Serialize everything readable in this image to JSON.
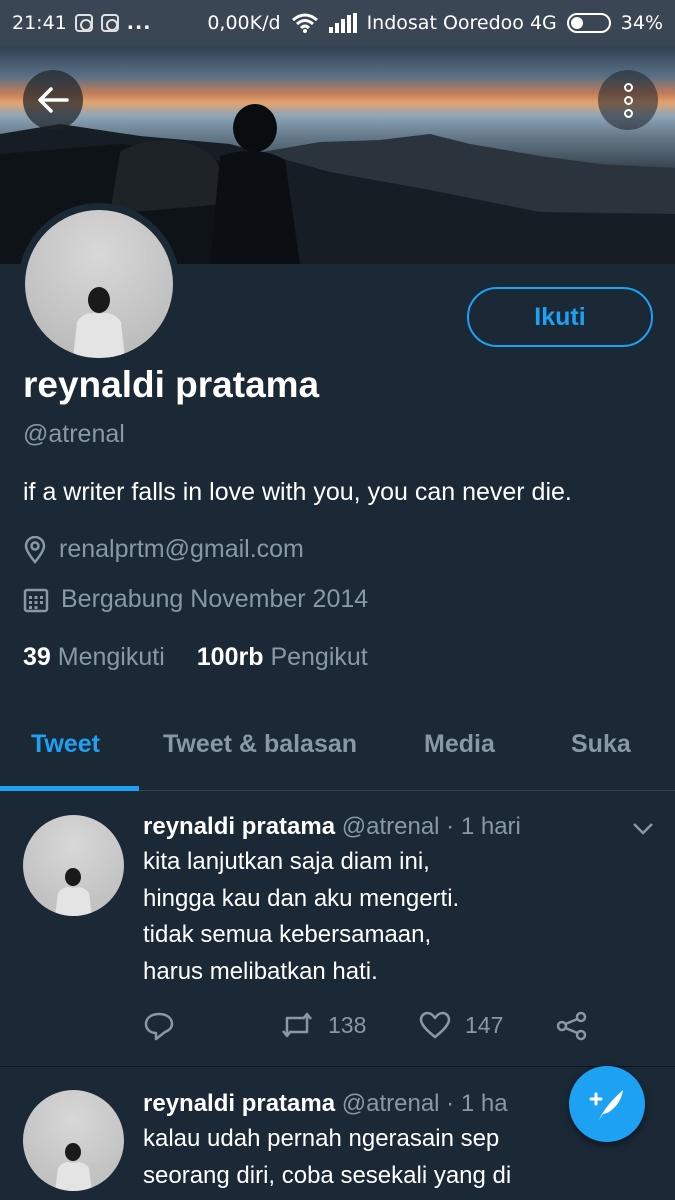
{
  "status_bar": {
    "time": "21:41",
    "dots": "...",
    "speed": "0,00K/d",
    "carrier": "Indosat Ooredoo 4G",
    "battery": "34%",
    "battery_level": 0.34
  },
  "profile": {
    "name": "reynaldi pratama",
    "handle": "@atrenal",
    "bio": "if a writer falls in love with you, you can never die.",
    "email": "renalprtm@gmail.com",
    "joined": "Bergabung November 2014",
    "following_count": "39",
    "following_label": "Mengikuti",
    "followers_count": "100rb",
    "followers_label": "Pengikut",
    "follow_button": "Ikuti"
  },
  "tabs": [
    {
      "label": "Tweet",
      "active": true
    },
    {
      "label": "Tweet & balasan",
      "active": false
    },
    {
      "label": "Media",
      "active": false
    },
    {
      "label": "Suka",
      "active": false
    }
  ],
  "tweets": [
    {
      "name": "reynaldi pratama",
      "meta": "@atrenal · 1 hari",
      "lines": [
        "kita lanjutkan saja diam ini,",
        "hingga kau dan aku mengerti.",
        "tidak semua kebersamaan,",
        "harus melibatkan hati."
      ],
      "retweets": "138",
      "likes": "147"
    },
    {
      "name": "reynaldi pratama",
      "meta": "@atrenal · 1 ha",
      "lines": [
        "kalau udah pernah ngerasain sep",
        "seorang diri, coba sesekali yang di"
      ]
    }
  ],
  "colors": {
    "background": "#1b2836",
    "accent": "#1da1f2",
    "secondary_text": "#8899a6"
  },
  "icons": [
    "back-arrow-icon",
    "more-vertical-icon",
    "location-icon",
    "calendar-icon",
    "chevron-down-icon",
    "reply-icon",
    "retweet-icon",
    "heart-icon",
    "share-icon",
    "compose-tweet-icon"
  ]
}
